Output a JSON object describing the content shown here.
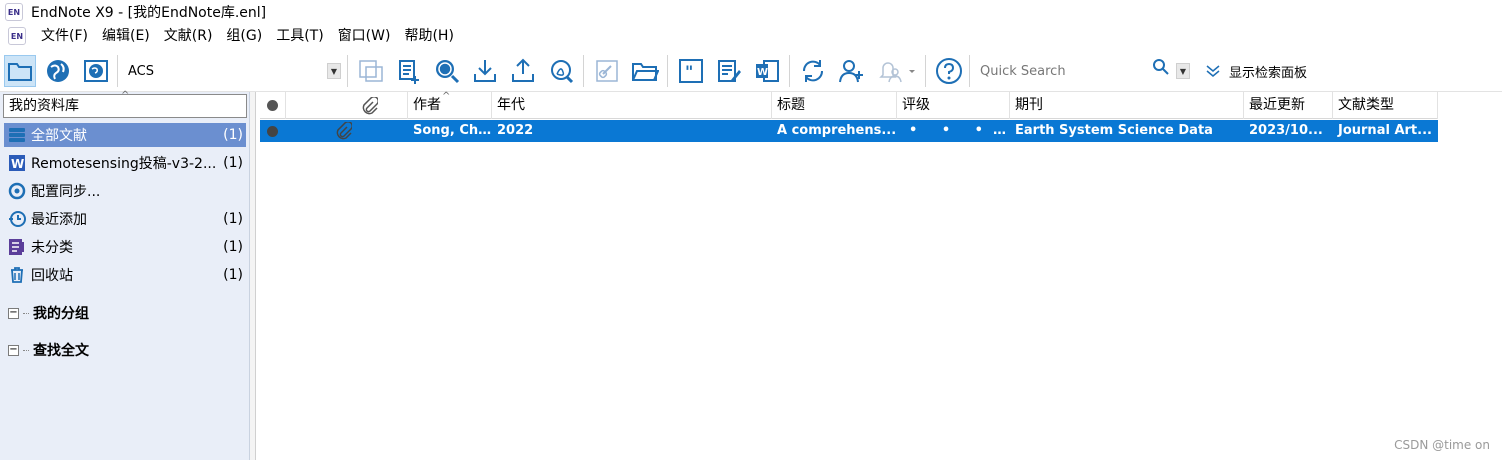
{
  "window": {
    "title": "EndNote X9 - [我的EndNote库.enl]",
    "logo_text": "EN"
  },
  "menu": [
    "文件(F)",
    "编辑(E)",
    "文献(R)",
    "组(G)",
    "工具(T)",
    "窗口(W)",
    "帮助(H)"
  ],
  "toolbar": {
    "style_value": "ACS",
    "quick_search_placeholder": "Quick Search",
    "show_search_panel": "显示检索面板"
  },
  "groups_panel": {
    "header": "我的资料库",
    "items": [
      {
        "label": "全部文献",
        "count": "(1)",
        "icon": "all-references-icon",
        "selected": true
      },
      {
        "label": "Remotesensing投稿-v3-2...",
        "count": "(1)",
        "icon": "word-doc-icon"
      },
      {
        "label": "配置同步...",
        "count": "",
        "icon": "sync-icon"
      },
      {
        "label": "最近添加",
        "count": "(1)",
        "icon": "clock-icon"
      },
      {
        "label": "未分类",
        "count": "(1)",
        "icon": "unfiled-icon"
      },
      {
        "label": "回收站",
        "count": "(1)",
        "icon": "trash-icon"
      }
    ],
    "sections": [
      {
        "label": "我的分组"
      },
      {
        "label": "查找全文"
      }
    ]
  },
  "table": {
    "columns": [
      "",
      "",
      "作者",
      "年代",
      "标题",
      "评级",
      "期刊",
      "最近更新",
      "文献类型"
    ],
    "rows": [
      {
        "author": "Song, Ch...",
        "year": "2022",
        "title": "A comprehens...",
        "rating": "• • • • •",
        "journal": "Earth System Science Data",
        "updated": "2023/10...",
        "type": "Journal Art..."
      }
    ]
  },
  "watermark": "CSDN @time on",
  "colors": {
    "selection": "#0a78d4",
    "group_selected": "#6b8fd0",
    "left_pane_bg": "#e9eef8",
    "accent_blue": "#1e6fb5"
  }
}
